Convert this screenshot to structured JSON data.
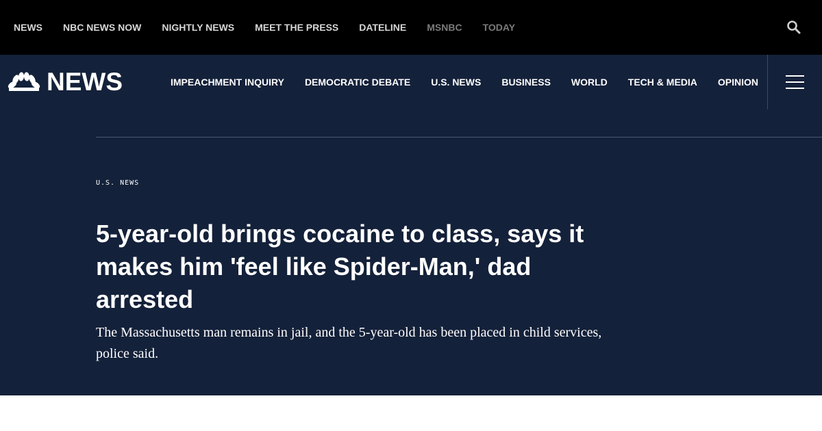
{
  "topbar": {
    "links": [
      {
        "label": "NEWS",
        "dim": false
      },
      {
        "label": "NBC NEWS NOW",
        "dim": false
      },
      {
        "label": "NIGHTLY NEWS",
        "dim": false
      },
      {
        "label": "MEET THE PRESS",
        "dim": false
      },
      {
        "label": "DATELINE",
        "dim": false
      },
      {
        "label": "MSNBC",
        "dim": true
      },
      {
        "label": "TODAY",
        "dim": true
      }
    ],
    "search_icon": "search-icon"
  },
  "mainnav": {
    "brand": "NEWS",
    "logo_icon": "peacock-logo",
    "sections": [
      "IMPEACHMENT INQUIRY",
      "DEMOCRATIC DEBATE",
      "U.S. NEWS",
      "BUSINESS",
      "WORLD",
      "TECH & MEDIA",
      "OPINION"
    ],
    "menu_icon": "hamburger-menu-icon"
  },
  "article": {
    "eyebrow": "U.S. NEWS",
    "headline": "5-year-old brings cocaine to class, says it makes him 'feel like Spider-Man,' dad arrested",
    "dek": "The Massachusetts man remains in jail, and the 5-year-old has been placed in child services, police said."
  },
  "colors": {
    "topbar_bg": "#000000",
    "nav_bg": "#14213a",
    "text": "#ffffff",
    "dim_link": "#7a7a7a"
  }
}
